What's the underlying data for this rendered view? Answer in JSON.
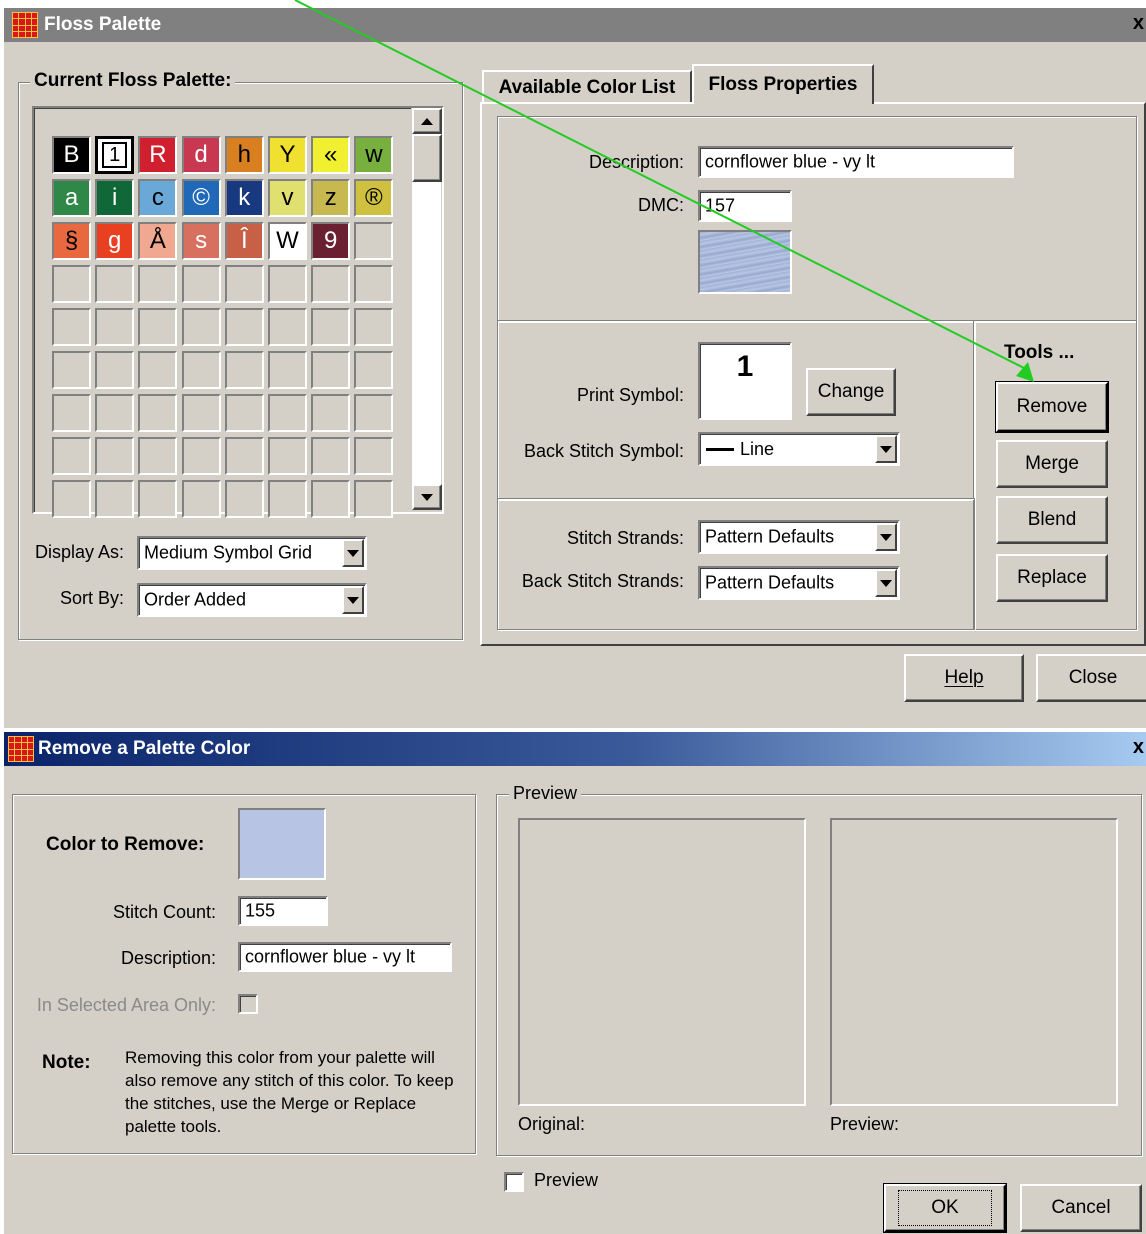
{
  "floss_window": {
    "title": "Floss Palette",
    "current_palette_label": "Current Floss Palette:",
    "palette_cells": [
      {
        "symbol": "B",
        "bg": "#000000",
        "fg": "#ffffff"
      },
      {
        "symbol": "1",
        "bg": "#ffffff",
        "fg": "#000000",
        "selected": true
      },
      {
        "symbol": "R",
        "bg": "#d02030",
        "fg": "#ffffff"
      },
      {
        "symbol": "d",
        "bg": "#c83850",
        "fg": "#ffffff"
      },
      {
        "symbol": "h",
        "bg": "#d88020",
        "fg": "#000000"
      },
      {
        "symbol": "Y",
        "bg": "#f0e030",
        "fg": "#000000"
      },
      {
        "symbol": "«",
        "bg": "#f0f030",
        "fg": "#000000"
      },
      {
        "symbol": "w",
        "bg": "#78b040",
        "fg": "#000000"
      },
      {
        "symbol": "a",
        "bg": "#308848",
        "fg": "#ffffff"
      },
      {
        "symbol": "i",
        "bg": "#106838",
        "fg": "#ffffff"
      },
      {
        "symbol": "c",
        "bg": "#6aa8d8",
        "fg": "#000000"
      },
      {
        "symbol": "©",
        "bg": "#2068b8",
        "fg": "#ffffff"
      },
      {
        "symbol": "k",
        "bg": "#183880",
        "fg": "#ffffff"
      },
      {
        "symbol": "v",
        "bg": "#e0e070",
        "fg": "#000000"
      },
      {
        "symbol": "z",
        "bg": "#c8b850",
        "fg": "#000000"
      },
      {
        "symbol": "®",
        "bg": "#d0c040",
        "fg": "#000000"
      },
      {
        "symbol": "§",
        "bg": "#e86840",
        "fg": "#000000"
      },
      {
        "symbol": "g",
        "bg": "#e84020",
        "fg": "#ffffff"
      },
      {
        "symbol": "Å",
        "bg": "#f0a890",
        "fg": "#000000"
      },
      {
        "symbol": "s",
        "bg": "#d87060",
        "fg": "#ffffff"
      },
      {
        "symbol": "Î",
        "bg": "#c86048",
        "fg": "#ffffff"
      },
      {
        "symbol": "W",
        "bg": "#ffffff",
        "fg": "#000000"
      },
      {
        "symbol": "9",
        "bg": "#6a2030",
        "fg": "#ffffff"
      },
      {
        "symbol": "",
        "bg": "#d4d0c8",
        "fg": "#000000"
      }
    ],
    "display_as_label": "Display As:",
    "display_as_value": "Medium Symbol Grid",
    "sort_by_label": "Sort By:",
    "sort_by_value": "Order Added",
    "tabs": [
      {
        "label": "Available Color List",
        "active": false
      },
      {
        "label": "Floss Properties",
        "active": true
      }
    ],
    "description_label": "Description:",
    "description_value": "cornflower blue - vy lt",
    "dmc_label": "DMC:",
    "dmc_value": "157",
    "swatch_color": "#a8b8d8",
    "print_symbol_label": "Print Symbol:",
    "print_symbol_value": "1",
    "change_button": "Change",
    "back_stitch_symbol_label": "Back Stitch Symbol:",
    "back_stitch_symbol_value": "Line",
    "stitch_strands_label": "Stitch Strands:",
    "stitch_strands_value": "Pattern Defaults",
    "back_stitch_strands_label": "Back Stitch Strands:",
    "back_stitch_strands_value": "Pattern Defaults",
    "tools_label": "Tools ...",
    "tools_buttons": {
      "remove": "Remove",
      "merge": "Merge",
      "blend": "Blend",
      "replace": "Replace"
    },
    "help_button": "Help",
    "close_button": "Close"
  },
  "remove_dialog": {
    "title": "Remove a Palette Color",
    "color_to_remove_label": "Color to Remove:",
    "color_to_remove_swatch": "#b8c4e4",
    "stitch_count_label": "Stitch Count:",
    "stitch_count_value": "155",
    "description_label": "Description:",
    "description_value": "cornflower blue - vy lt",
    "selected_area_label": "In Selected Area Only:",
    "note_label": "Note:",
    "note_text": "Removing this color from your palette will also remove any stitch of this color.  To keep the stitches, use the Merge or Replace palette tools.",
    "preview_group_label": "Preview",
    "original_caption": "Original:",
    "preview_caption": "Preview:",
    "preview_checkbox_label": "Preview",
    "ok_button": "OK",
    "cancel_button": "Cancel"
  },
  "colors": {
    "face": "#d4d0c8",
    "title_gray": "#808080",
    "title_blue_start": "#0a246a",
    "title_blue_end": "#a6caf0",
    "annotation_arrow": "#22cc22"
  }
}
